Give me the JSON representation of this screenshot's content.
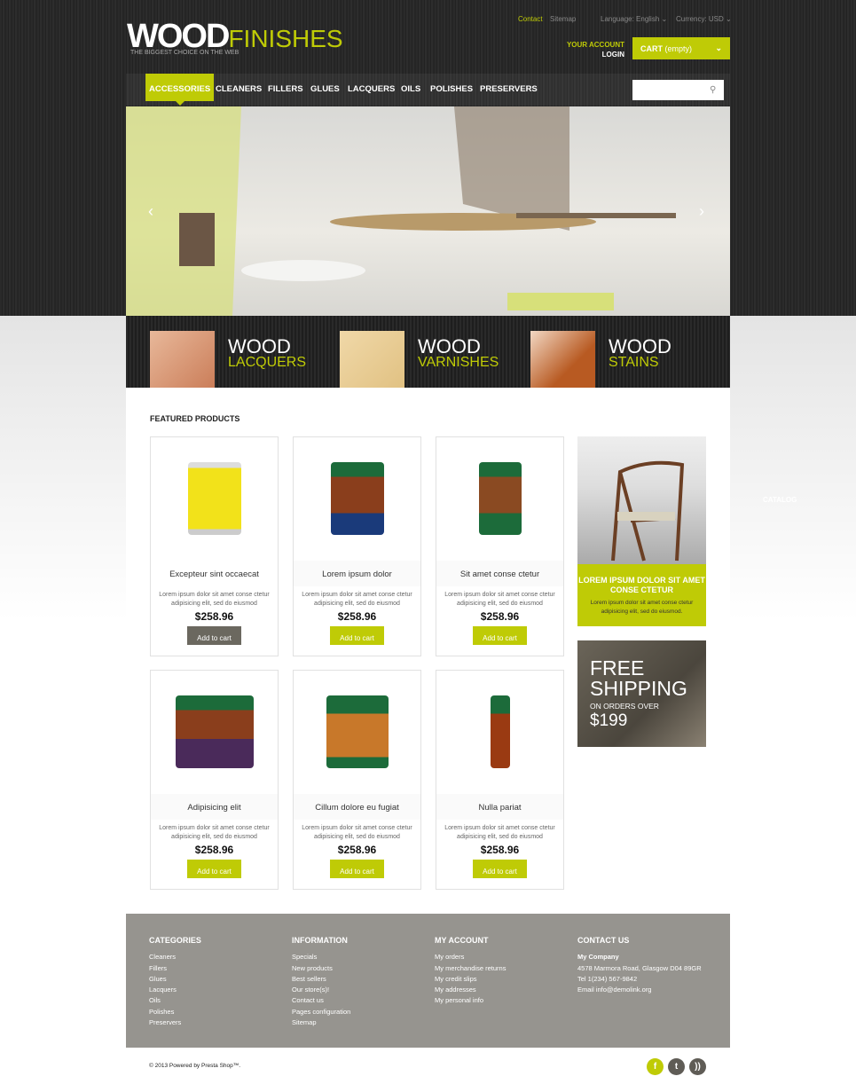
{
  "header": {
    "logo_bold": "WOOD",
    "logo_light": "FINISHES",
    "tagline": "THE BIGGEST CHOICE ON THE WEB",
    "links": {
      "contact": "Contact",
      "sitemap": "Sitemap"
    },
    "language": "Language: English ⌄",
    "currency": "Currency: USD ⌄",
    "your_account": "YOUR ACCOUNT",
    "login": "LOGIN",
    "cart_label": "CART",
    "cart_status": "(empty)",
    "search_placeholder": ""
  },
  "nav": [
    "ACCESSORIES",
    "CLEANERS",
    "FILLERS",
    "GLUES",
    "LACQUERS",
    "OILS",
    "POLISHES",
    "PRESERVERS"
  ],
  "categories": [
    {
      "word": "WOOD",
      "sub": "LACQUERS"
    },
    {
      "word": "WOOD",
      "sub": "VARNISHES"
    },
    {
      "word": "WOOD",
      "sub": "STAINS"
    }
  ],
  "featured_title": "FEATURED PRODUCTS",
  "products": [
    {
      "name": "Excepteur sint occaecat",
      "desc": "Lorem ipsum dolor sit amet conse ctetur adipisicing elit, sed do eiusmod",
      "price": "$258.96",
      "button": "Add to cart"
    },
    {
      "name": "Lorem ipsum dolor",
      "desc": "Lorem ipsum dolor sit amet conse ctetur adipisicing elit, sed do eiusmod",
      "price": "$258.96",
      "button": "Add to cart"
    },
    {
      "name": "Sit amet conse ctetur",
      "desc": "Lorem ipsum dolor sit amet conse ctetur adipisicing elit, sed do eiusmod",
      "price": "$258.96",
      "button": "Add to cart"
    },
    {
      "name": "Adipisicing elit",
      "desc": "Lorem ipsum dolor sit amet conse ctetur adipisicing elit, sed do eiusmod",
      "price": "$258.96",
      "button": "Add to cart"
    },
    {
      "name": "Cillum dolore eu fugiat",
      "desc": "Lorem ipsum dolor sit amet conse ctetur adipisicing elit, sed do eiusmod",
      "price": "$258.96",
      "button": "Add to cart"
    },
    {
      "name": "Nulla pariat",
      "desc": "Lorem ipsum dolor sit amet conse ctetur adipisicing elit, sed do eiusmod",
      "price": "$258.96",
      "button": "Add to cart"
    }
  ],
  "promo": {
    "title": "LOREM IPSUM DOLOR SIT AMET CONSE CTETUR",
    "text": "Lorem ipsum dolor sit amet conse ctetur adipisicing elit, sed do eiusmod."
  },
  "shipping": {
    "line1": "FREE",
    "line2": "SHIPPING",
    "line3": "ON ORDERS OVER",
    "amount": "$199"
  },
  "catalog_label": "CATALOG",
  "footer": {
    "categories": {
      "title": "CATEGORIES",
      "items": [
        "Cleaners",
        "Fillers",
        "Glues",
        "Lacquers",
        "Oils",
        "Polishes",
        "Preservers"
      ]
    },
    "information": {
      "title": "INFORMATION",
      "items": [
        "Specials",
        "New products",
        "Best sellers",
        "Our store(s)!",
        "Contact us",
        "Pages configuration",
        "Sitemap"
      ]
    },
    "account": {
      "title": "MY ACCOUNT",
      "items": [
        "My orders",
        "My merchandise returns",
        "My credit slips",
        "My addresses",
        "My personal info"
      ]
    },
    "contact": {
      "title": "CONTACT US",
      "company": "My Company",
      "address": "4578 Marmora Road, Glasgow D04 89GR",
      "tel": "Tel 1(234) 567-9842",
      "email": "Email info@demolink.org"
    },
    "copyright": "© 2013 Powered by Presta Shop™."
  },
  "colors": {
    "accent": "#bfcb06",
    "footer": "#96948f",
    "dark_button": "#6b685f"
  }
}
